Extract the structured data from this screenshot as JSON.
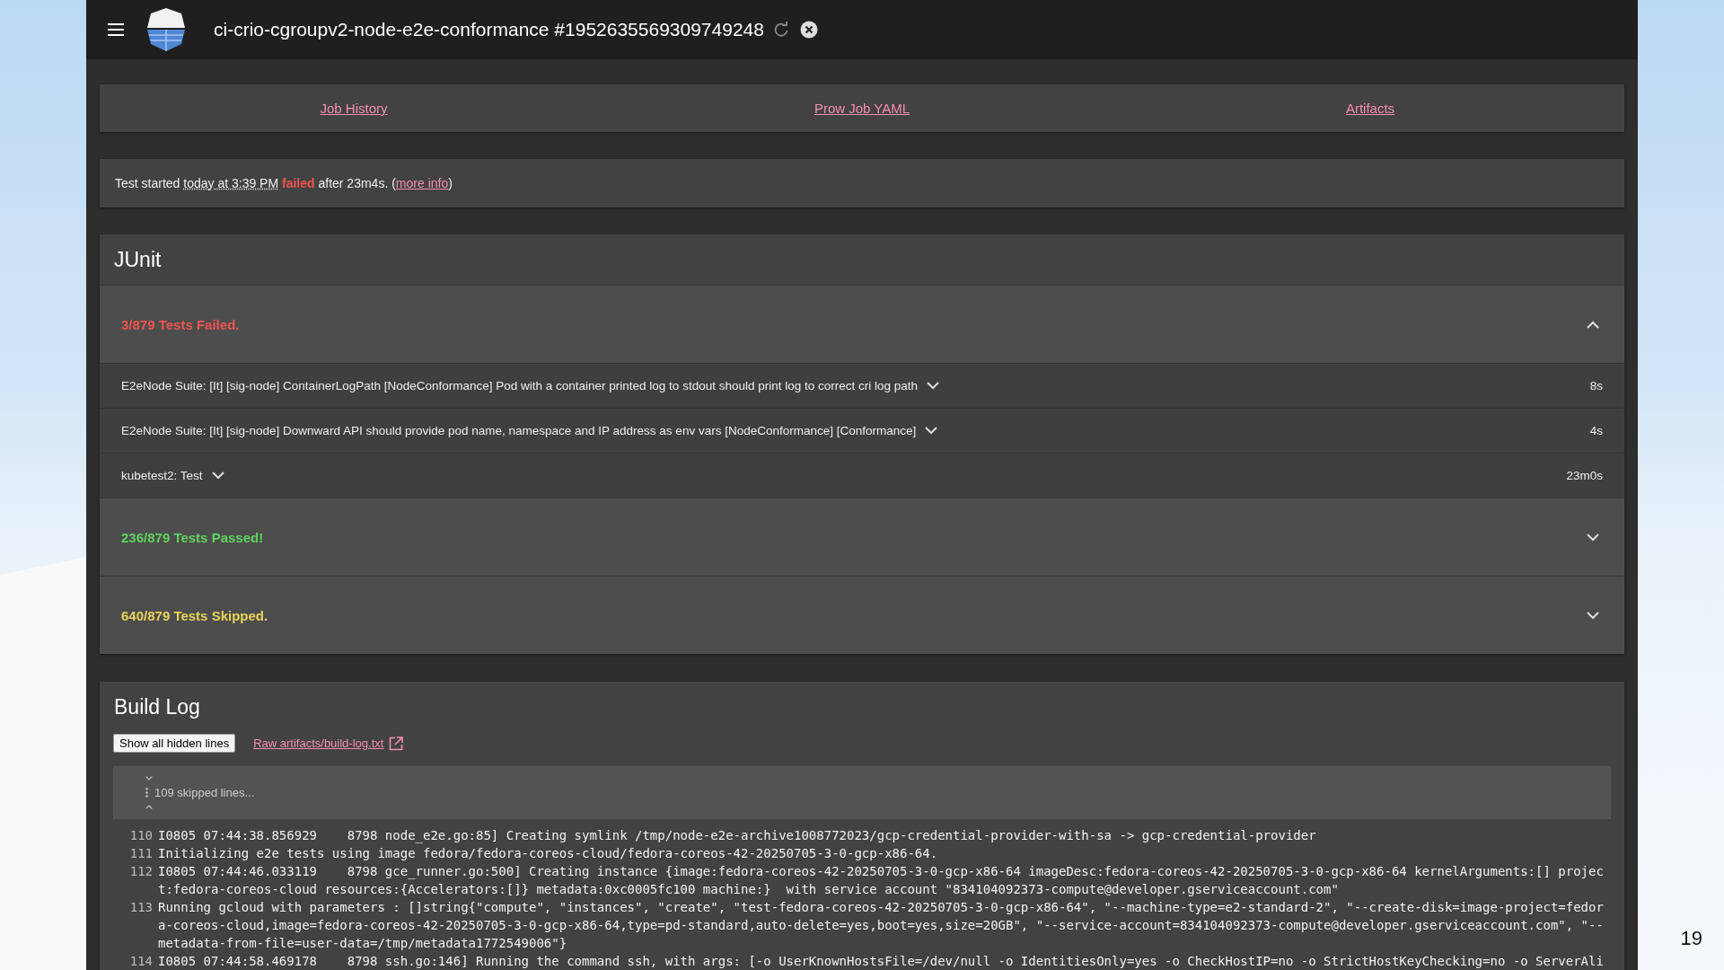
{
  "slide": {
    "page_number": "19"
  },
  "header": {
    "title": "ci-crio-cgroupv2-node-e2e-conformance #1952635569309749248"
  },
  "nav_links": [
    "Job History",
    "Prow Job YAML",
    "Artifacts"
  ],
  "summary": {
    "prefix": "Test started",
    "time": "today at 3:39 PM",
    "result": "failed",
    "suffix": "after 23m4s. (",
    "link": "more info",
    "close": ")"
  },
  "junit": {
    "title": "JUnit",
    "groups": [
      {
        "kind": "failed",
        "label": "3/879 Tests Failed.",
        "expanded": true,
        "tests": [
          {
            "name": "E2eNode Suite: [It] [sig-node] ContainerLogPath [NodeConformance] Pod with a container printed log to stdout should print log to correct cri log path",
            "duration": "8s",
            "expanded": false
          },
          {
            "name": "E2eNode Suite: [It] [sig-node] Downward API should provide pod name, namespace and IP address as env vars [NodeConformance] [Conformance]",
            "duration": "4s",
            "expanded": false
          },
          {
            "name": "kubetest2: Test",
            "duration": "23m0s",
            "expanded": false
          }
        ]
      },
      {
        "kind": "passed",
        "label": "236/879 Tests Passed!",
        "expanded": false
      },
      {
        "kind": "skipped",
        "label": "640/879 Tests Skipped.",
        "expanded": false
      }
    ]
  },
  "build_log": {
    "title": "Build Log",
    "show_button": "Show all hidden lines",
    "raw_link": "Raw artifacts/build-log.txt",
    "skipped": "109 skipped lines...",
    "lines": [
      {
        "number": "110",
        "text": "I0805 07:44:38.856929    8798 node_e2e.go:85] Creating symlink /tmp/node-e2e-archive1008772023/gcp-credential-provider-with-sa -> gcp-credential-provider"
      },
      {
        "number": "111",
        "text": "Initializing e2e tests using image fedora/fedora-coreos-cloud/fedora-coreos-42-20250705-3-0-gcp-x86-64."
      },
      {
        "number": "112",
        "text": "I0805 07:44:46.033119    8798 gce_runner.go:500] Creating instance {image:fedora-coreos-42-20250705-3-0-gcp-x86-64 imageDesc:fedora-coreos-42-20250705-3-0-gcp-x86-64 kernelArguments:[] project:fedora-coreos-cloud resources:{Accelerators:[]} metadata:0xc0005fc100 machine:}  with service account \"834104092373-compute@developer.gserviceaccount.com\""
      },
      {
        "number": "113",
        "text": "Running gcloud with parameters : []string{\"compute\", \"instances\", \"create\", \"test-fedora-coreos-42-20250705-3-0-gcp-x86-64\", \"--machine-type=e2-standard-2\", \"--create-disk=image-project=fedora-coreos-cloud,image=fedora-coreos-42-20250705-3-0-gcp-x86-64,type=pd-standard,auto-delete=yes,boot=yes,size=20GB\", \"--service-account=834104092373-compute@developer.gserviceaccount.com\", \"--metadata-from-file=user-data=/tmp/metadata1772549006\"}"
      },
      {
        "number": "114",
        "text": "I0805 07:44:58.469178    8798 ssh.go:146] Running the command ssh, with args: [-o UserKnownHostsFile=/dev/null -o IdentitiesOnly=yes -o CheckHostIP=no -o StrictHostKeyChecking=no -o ServerAli"
      }
    ]
  }
}
